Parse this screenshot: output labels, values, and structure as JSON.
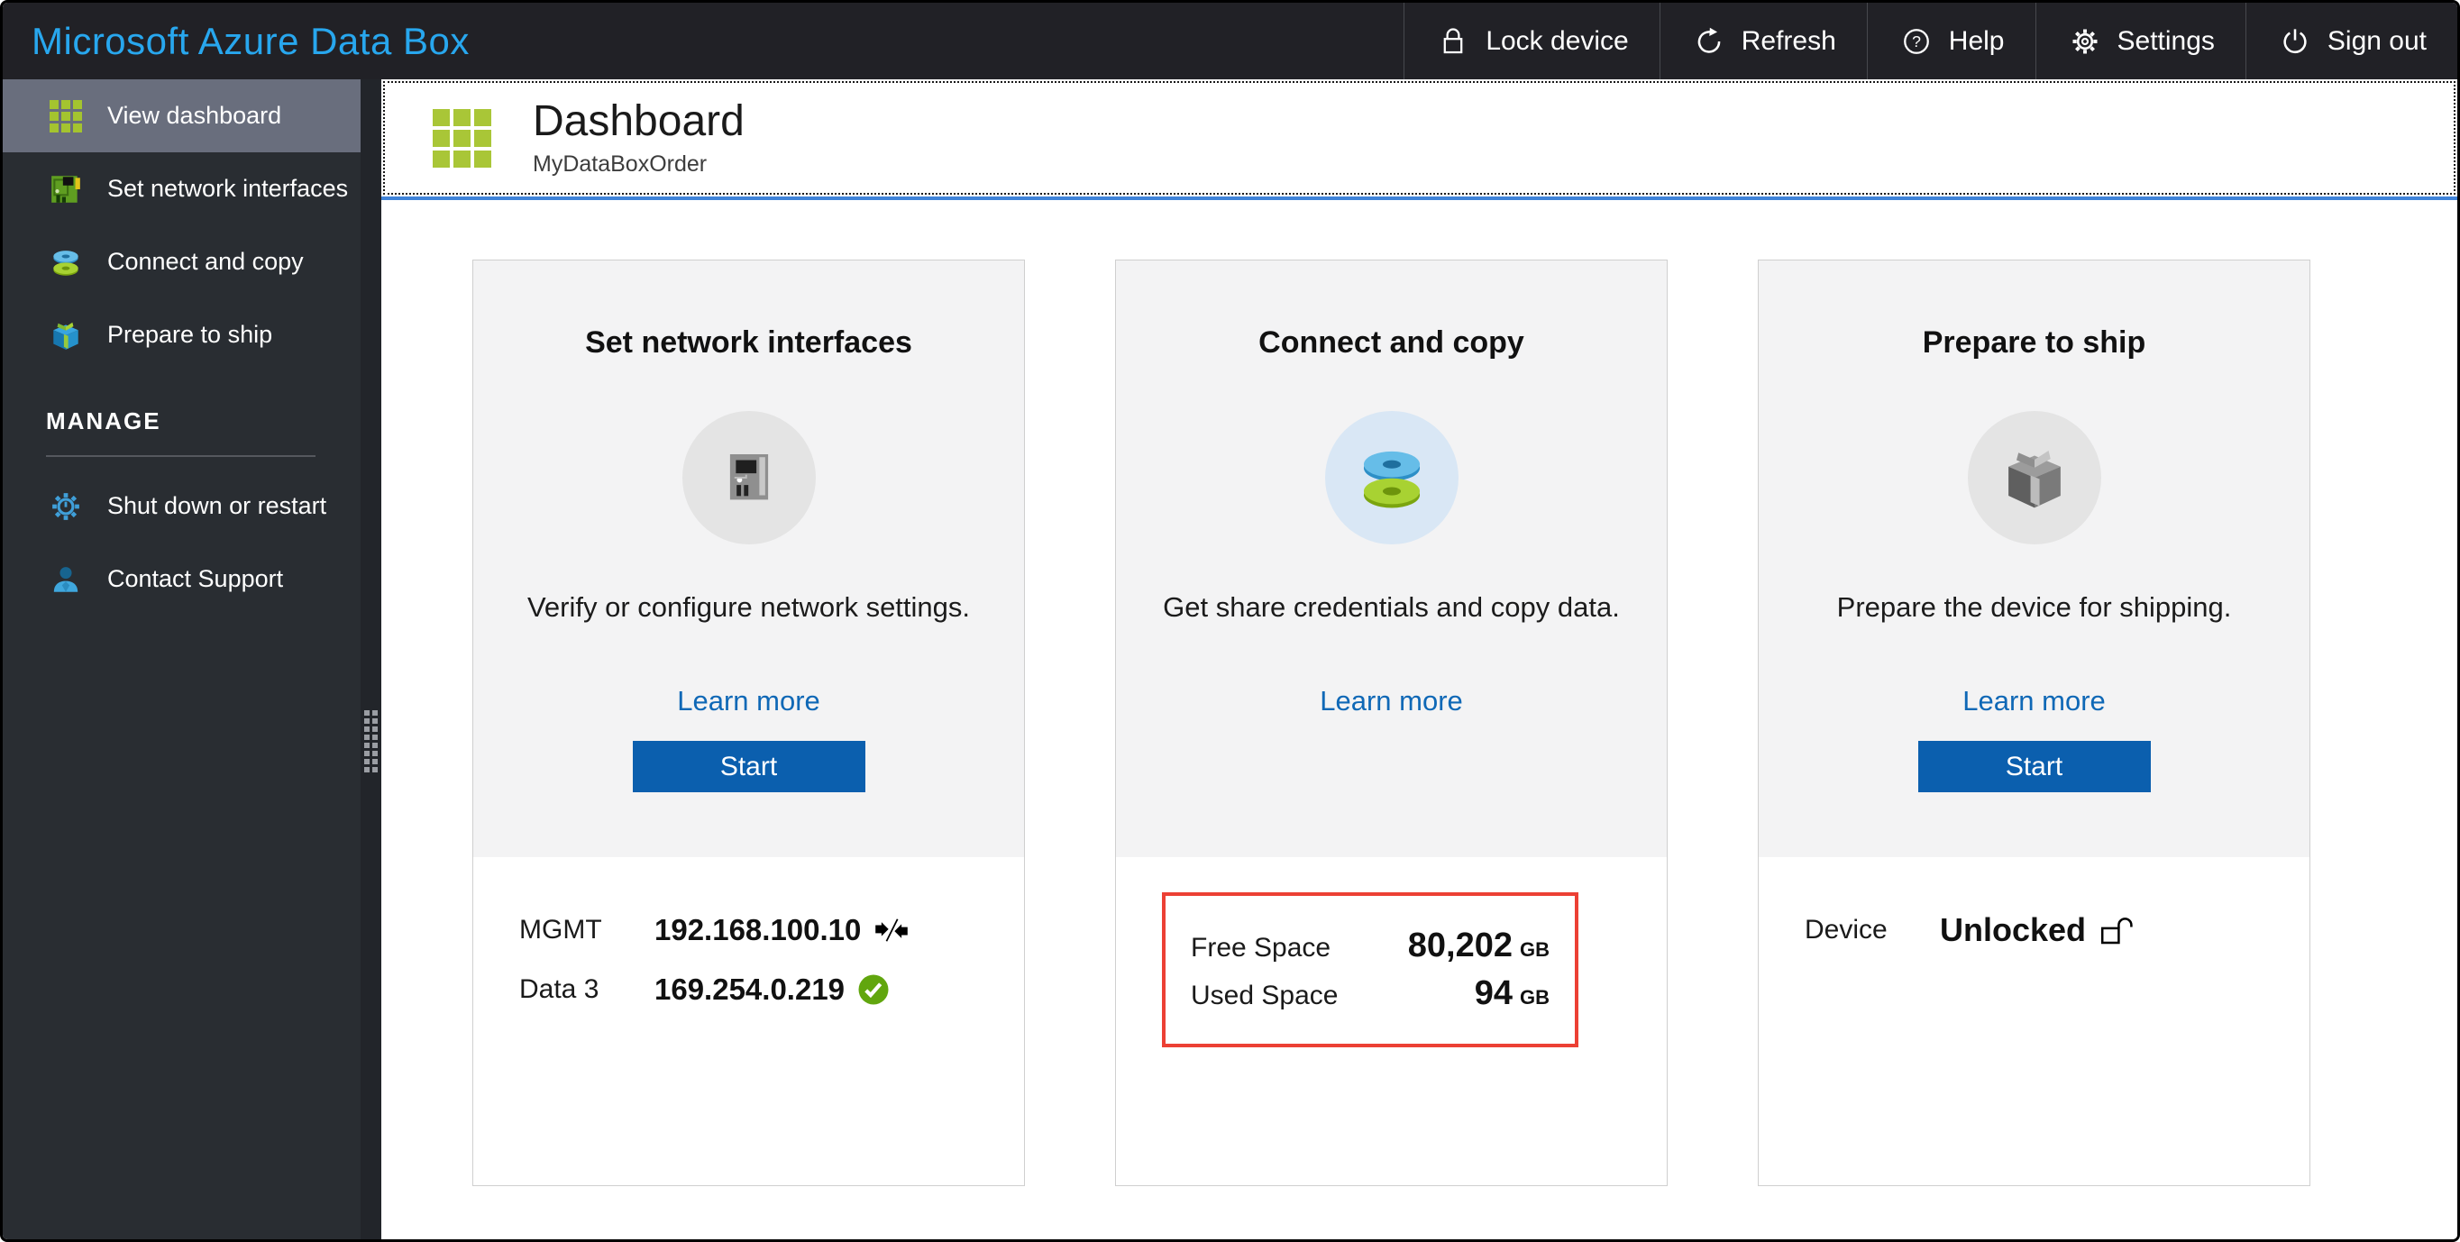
{
  "topbar": {
    "title": "Microsoft Azure Data Box",
    "buttons": [
      {
        "label": "Lock device",
        "icon": "lock-icon"
      },
      {
        "label": "Refresh",
        "icon": "refresh-icon"
      },
      {
        "label": "Help",
        "icon": "help-icon"
      },
      {
        "label": "Settings",
        "icon": "settings-gear-icon"
      },
      {
        "label": "Sign out",
        "icon": "power-icon"
      }
    ]
  },
  "sidebar": {
    "items": [
      {
        "label": "View dashboard",
        "icon": "grid-icon",
        "selected": true
      },
      {
        "label": "Set network interfaces",
        "icon": "network-card-icon",
        "selected": false
      },
      {
        "label": "Connect and copy",
        "icon": "disk-stack-icon",
        "selected": false
      },
      {
        "label": "Prepare to ship",
        "icon": "gift-box-icon",
        "selected": false
      }
    ],
    "section_header": "MANAGE",
    "manage_items": [
      {
        "label": "Shut down or restart",
        "icon": "power-gear-icon"
      },
      {
        "label": "Contact Support",
        "icon": "person-icon"
      }
    ]
  },
  "header": {
    "title": "Dashboard",
    "subtitle": "MyDataBoxOrder"
  },
  "cards": [
    {
      "title": "Set network interfaces",
      "icon": "network-card-icon",
      "description": "Verify or configure network settings.",
      "learn_more_label": "Learn more",
      "start_label": "Start",
      "details": [
        {
          "label": "MGMT",
          "value": "192.168.100.10",
          "icon": "plug-disconnected-icon"
        },
        {
          "label": "Data 3",
          "value": "169.254.0.219",
          "icon": "check-circle-icon"
        }
      ]
    },
    {
      "title": "Connect and copy",
      "icon": "disk-stack-icon",
      "description": "Get share credentials and copy data.",
      "learn_more_label": "Learn more",
      "space": [
        {
          "label": "Free Space",
          "value": "80,202",
          "unit": "GB"
        },
        {
          "label": "Used Space",
          "value": "94",
          "unit": "GB"
        }
      ]
    },
    {
      "title": "Prepare to ship",
      "icon": "gift-box-icon",
      "description": "Prepare the device for shipping.",
      "learn_more_label": "Learn more",
      "start_label": "Start",
      "details": [
        {
          "label": "Device",
          "value": "Unlocked",
          "icon": "unlock-icon"
        }
      ]
    }
  ],
  "colors": {
    "topbar_bg": "#212126",
    "brand_blue": "#28a7ee",
    "sidebar_bg": "#292d32",
    "sidebar_selected_bg": "#696e7d",
    "accent_green": "#a4c42f",
    "button_blue": "#0b5fae",
    "link_blue": "#0f68b6",
    "header_line_blue": "#3f83d9",
    "check_green": "#61a60e",
    "highlight_red": "#ec4034"
  }
}
